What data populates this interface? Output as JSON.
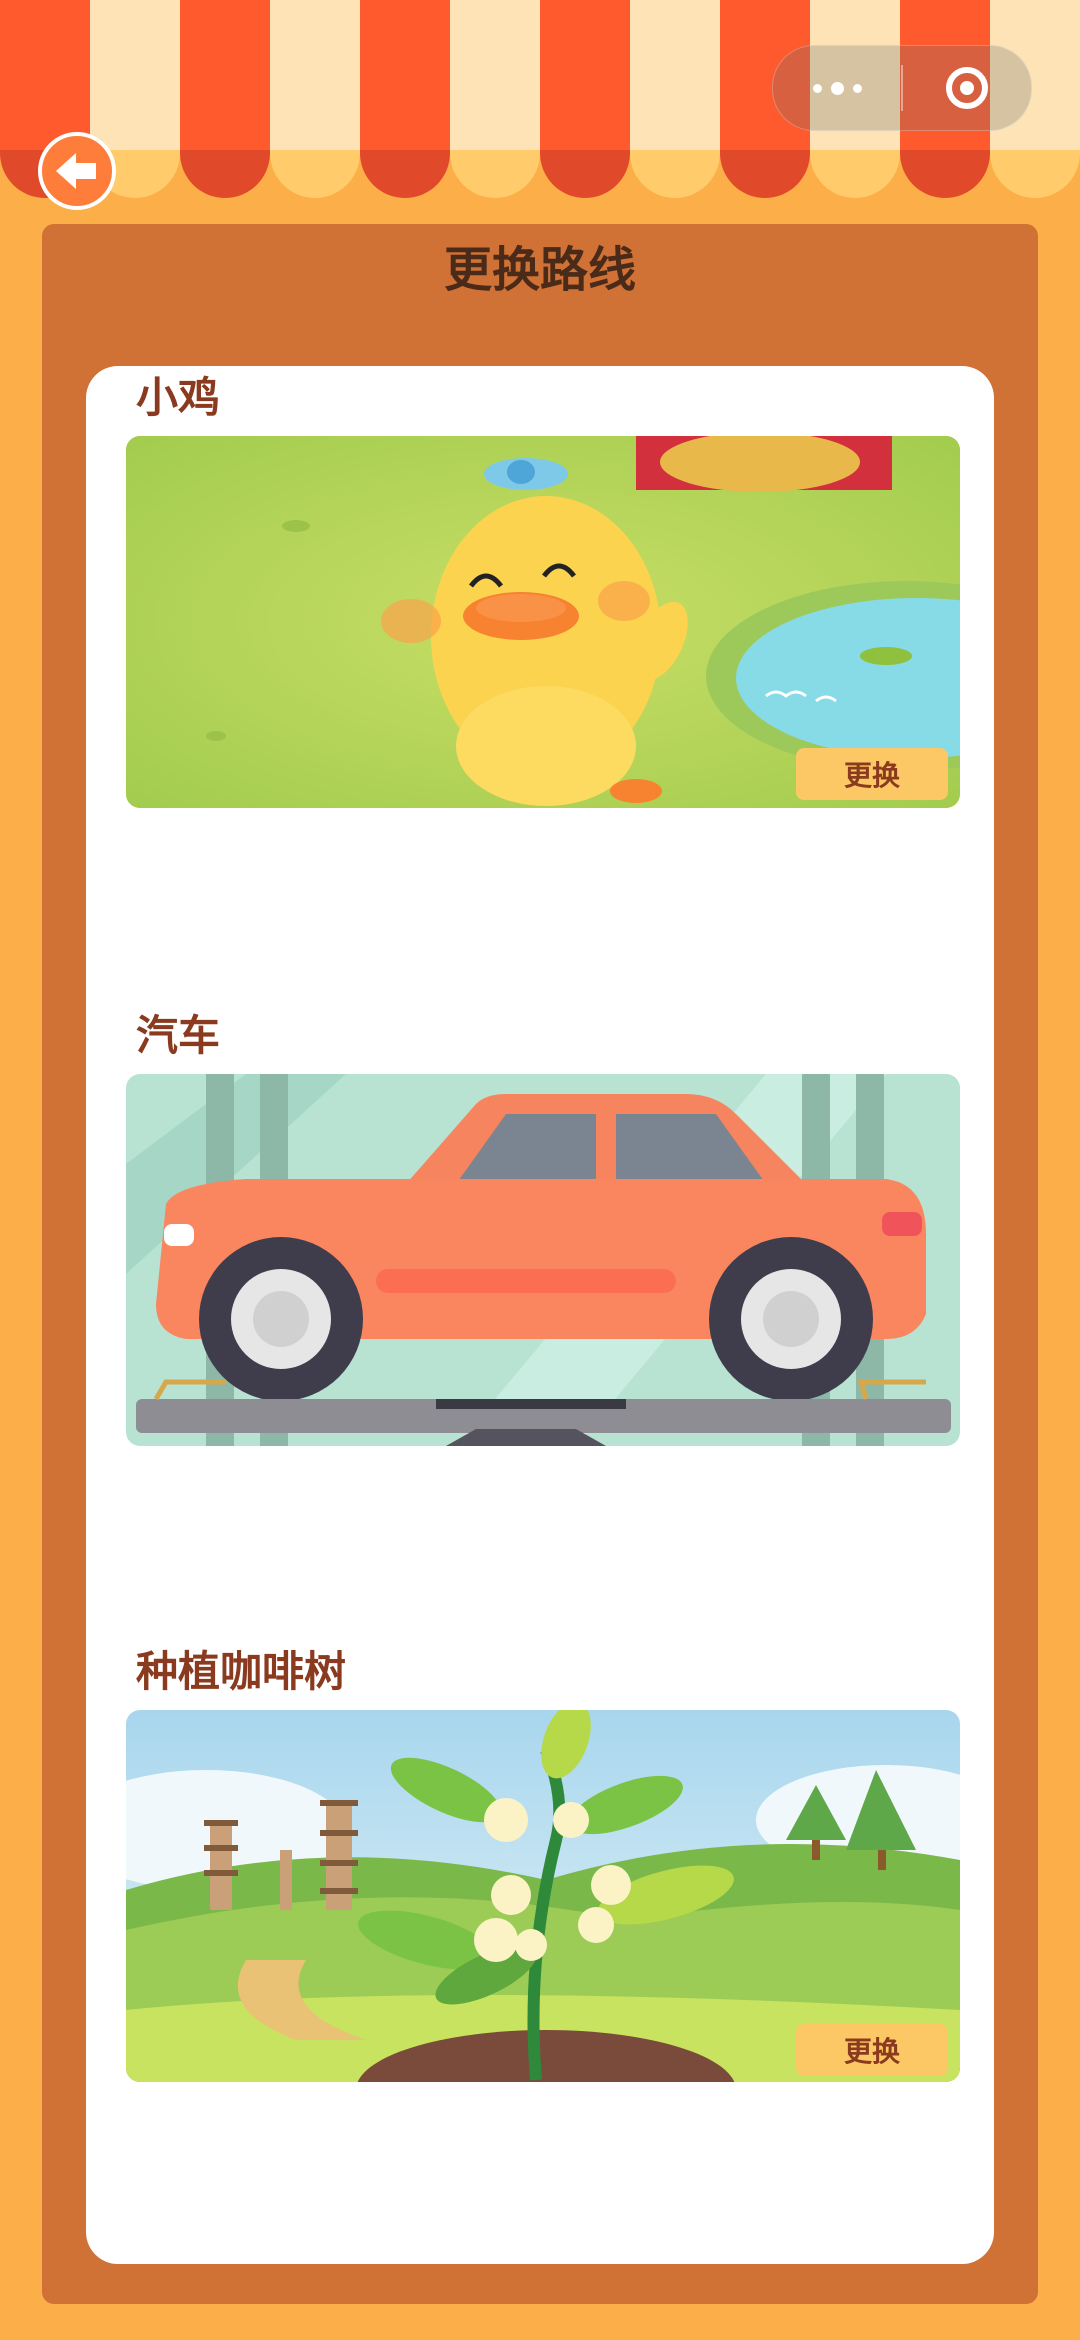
{
  "header": {
    "title": "更换路线"
  },
  "colors": {
    "background": "#FCAE48",
    "panel": "#D07136",
    "awning_red": "#FE5A2D",
    "awning_cream": "#FDE3B6",
    "label": "#8A3A1E",
    "button": "#FCC865"
  },
  "routes": [
    {
      "name": "小鸡",
      "image": "duckling-illustration",
      "button": "更换"
    },
    {
      "name": "汽车",
      "image": "car-illustration"
    },
    {
      "name": "种植咖啡树",
      "image": "coffee-tree-illustration",
      "button": "更换"
    }
  ],
  "icons": {
    "back": "back-arrow-icon",
    "menu": "more-dots-icon",
    "close": "target-close-icon"
  }
}
